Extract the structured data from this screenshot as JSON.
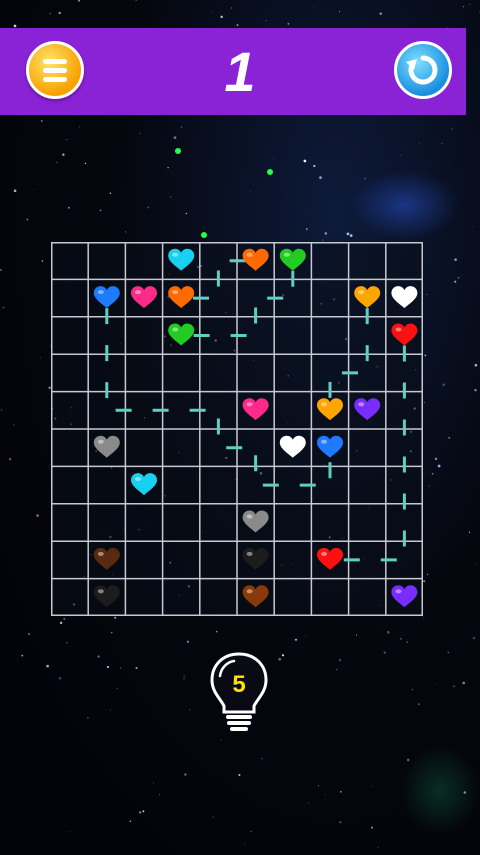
{
  "header": {
    "level": "1",
    "menu_icon": "menu-icon",
    "restart_icon": "restart-icon"
  },
  "hint": {
    "count": "5",
    "icon": "lightbulb-icon"
  },
  "colors": {
    "topbar": "#8a22d6",
    "path": "#5ecfc0",
    "cyan": "#19d0f0",
    "orange": "#ff6a00",
    "green": "#22cc22",
    "blue": "#1e7bff",
    "pink": "#ff2a8a",
    "amber": "#ffa500",
    "white": "#ffffff",
    "red": "#ff1010",
    "purple": "#7a2cff",
    "gray": "#8a8a8a",
    "brown": "#5a2a10",
    "black": "#1c1c1c",
    "darkorange": "#8a3a0a"
  },
  "grid": {
    "rows": 10,
    "cols": 10
  },
  "hearts": [
    {
      "row": 0,
      "col": 3,
      "color": "cyan"
    },
    {
      "row": 0,
      "col": 5,
      "color": "orange"
    },
    {
      "row": 0,
      "col": 6,
      "color": "green"
    },
    {
      "row": 1,
      "col": 1,
      "color": "blue"
    },
    {
      "row": 1,
      "col": 2,
      "color": "pink"
    },
    {
      "row": 1,
      "col": 3,
      "color": "orange"
    },
    {
      "row": 1,
      "col": 8,
      "color": "amber"
    },
    {
      "row": 1,
      "col": 9,
      "color": "white"
    },
    {
      "row": 2,
      "col": 3,
      "color": "green"
    },
    {
      "row": 2,
      "col": 9,
      "color": "red"
    },
    {
      "row": 4,
      "col": 5,
      "color": "pink"
    },
    {
      "row": 4,
      "col": 7,
      "color": "amber"
    },
    {
      "row": 4,
      "col": 8,
      "color": "purple"
    },
    {
      "row": 5,
      "col": 1,
      "color": "gray"
    },
    {
      "row": 5,
      "col": 6,
      "color": "white"
    },
    {
      "row": 5,
      "col": 7,
      "color": "blue"
    },
    {
      "row": 6,
      "col": 2,
      "color": "cyan"
    },
    {
      "row": 7,
      "col": 5,
      "color": "gray"
    },
    {
      "row": 8,
      "col": 1,
      "color": "brown"
    },
    {
      "row": 8,
      "col": 5,
      "color": "black"
    },
    {
      "row": 8,
      "col": 7,
      "color": "red"
    },
    {
      "row": 9,
      "col": 1,
      "color": "black"
    },
    {
      "row": 9,
      "col": 5,
      "color": "darkorange"
    },
    {
      "row": 9,
      "col": 9,
      "color": "purple"
    }
  ],
  "paths": [
    [
      [
        0,
        5
      ],
      [
        0,
        4
      ],
      [
        1,
        4
      ],
      [
        1,
        3
      ]
    ],
    [
      [
        0,
        6
      ],
      [
        1,
        6
      ],
      [
        1,
        5
      ],
      [
        2,
        5
      ],
      [
        2,
        4
      ],
      [
        2,
        3
      ]
    ],
    [
      [
        1,
        1
      ],
      [
        2,
        1
      ],
      [
        3,
        1
      ],
      [
        4,
        1
      ],
      [
        4,
        2
      ],
      [
        4,
        3
      ],
      [
        4,
        4
      ],
      [
        5,
        4
      ],
      [
        5,
        5
      ],
      [
        6,
        5
      ],
      [
        6,
        6
      ],
      [
        6,
        7
      ],
      [
        5,
        7
      ]
    ],
    [
      [
        1,
        8
      ],
      [
        2,
        8
      ],
      [
        3,
        8
      ],
      [
        3,
        7
      ],
      [
        4,
        7
      ]
    ],
    [
      [
        2,
        9
      ],
      [
        3,
        9
      ],
      [
        4,
        9
      ],
      [
        5,
        9
      ],
      [
        6,
        9
      ],
      [
        7,
        9
      ],
      [
        8,
        9
      ],
      [
        8,
        8
      ],
      [
        8,
        7
      ]
    ]
  ]
}
